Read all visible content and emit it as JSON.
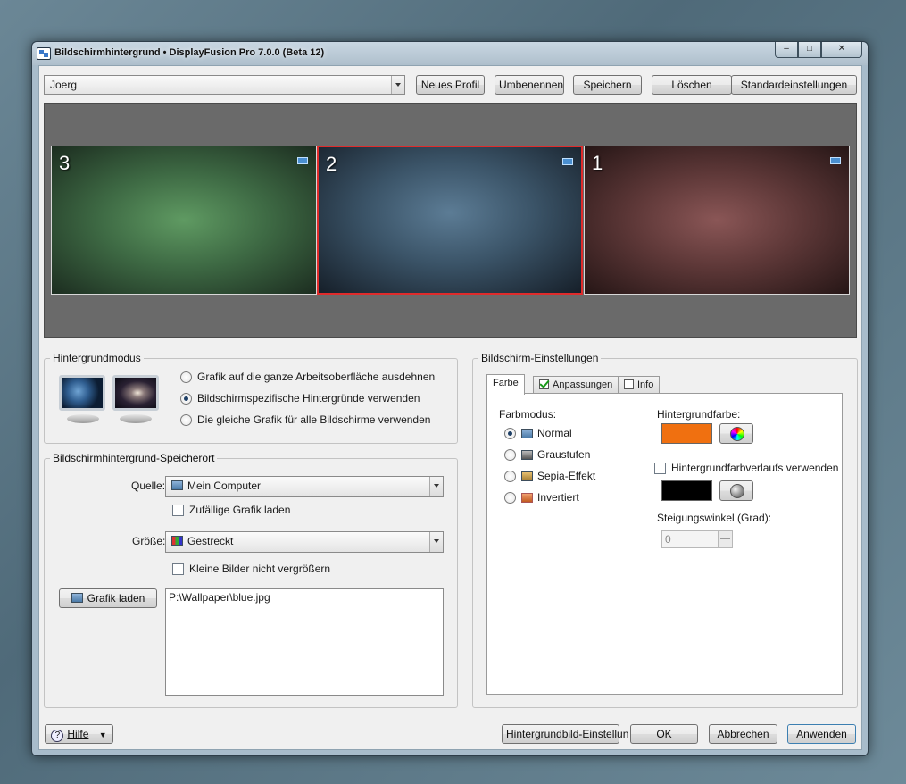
{
  "window": {
    "title": "Bildschirmhintergrund • DisplayFusion Pro 7.0.0 (Beta 12)",
    "controls": {
      "minimize": "–",
      "maximize": "□",
      "close": "✕"
    }
  },
  "profile": {
    "selected": "Joerg",
    "buttons": {
      "new": "Neues Profil",
      "rename": "Umbenennen",
      "save": "Speichern",
      "delete": "Löschen",
      "defaults": "Standardeinstellungen"
    }
  },
  "monitors": [
    {
      "number": "3",
      "color": "#4e8052",
      "selected": false
    },
    {
      "number": "2",
      "color": "#4a6a82",
      "selected": true
    },
    {
      "number": "1",
      "color": "#744848",
      "selected": false
    }
  ],
  "hintergrundmodus": {
    "label": "Hintergrundmodus",
    "options": [
      {
        "label": "Grafik auf die ganze Arbeitsoberfläche ausdehnen",
        "checked": false
      },
      {
        "label": "Bildschirmspezifische Hintergründe verwenden",
        "checked": true
      },
      {
        "label": "Die gleiche Grafik für alle Bildschirme verwenden",
        "checked": false
      }
    ]
  },
  "speicherort": {
    "label": "Bildschirmhintergrund-Speicherort",
    "source_label": "Quelle:",
    "source_value": "Mein Computer",
    "random_label": "Zufällige Grafik laden",
    "random_checked": false,
    "size_label": "Größe:",
    "size_value": "Gestreckt",
    "no_enlarge_label": "Kleine Bilder nicht vergrößern",
    "no_enlarge_checked": false,
    "load_button": "Grafik laden",
    "path": "P:\\Wallpaper\\blue.jpg"
  },
  "bildschirm_einstellungen": {
    "label": "Bildschirm-Einstellungen",
    "tabs": [
      {
        "label": "Farbe",
        "active": true
      },
      {
        "label": "Anpassungen",
        "active": false
      },
      {
        "label": "Info",
        "active": false
      }
    ],
    "farbmodus_label": "Farbmodus:",
    "farbmodus_options": [
      {
        "label": "Normal",
        "checked": true,
        "icon": "normal-image-icon"
      },
      {
        "label": "Graustufen",
        "checked": false,
        "icon": "grayscale-image-icon"
      },
      {
        "label": "Sepia-Effekt",
        "checked": false,
        "icon": "sepia-image-icon"
      },
      {
        "label": "Invertiert",
        "checked": false,
        "icon": "inverted-image-icon"
      }
    ],
    "bg_color_label": "Hintergrundfarbe:",
    "bg_color": "#f07010",
    "gradient_label": "Hintergrundfarbverlaufs verwenden",
    "gradient_checked": false,
    "gradient_color": "#000000",
    "angle_label": "Steigungswinkel (Grad):",
    "angle_value": "0"
  },
  "footer": {
    "help": "Hilfe",
    "wallpaper_settings": "Hintergrundbild-Einstellun",
    "ok": "OK",
    "cancel": "Abbrechen",
    "apply": "Anwenden"
  }
}
